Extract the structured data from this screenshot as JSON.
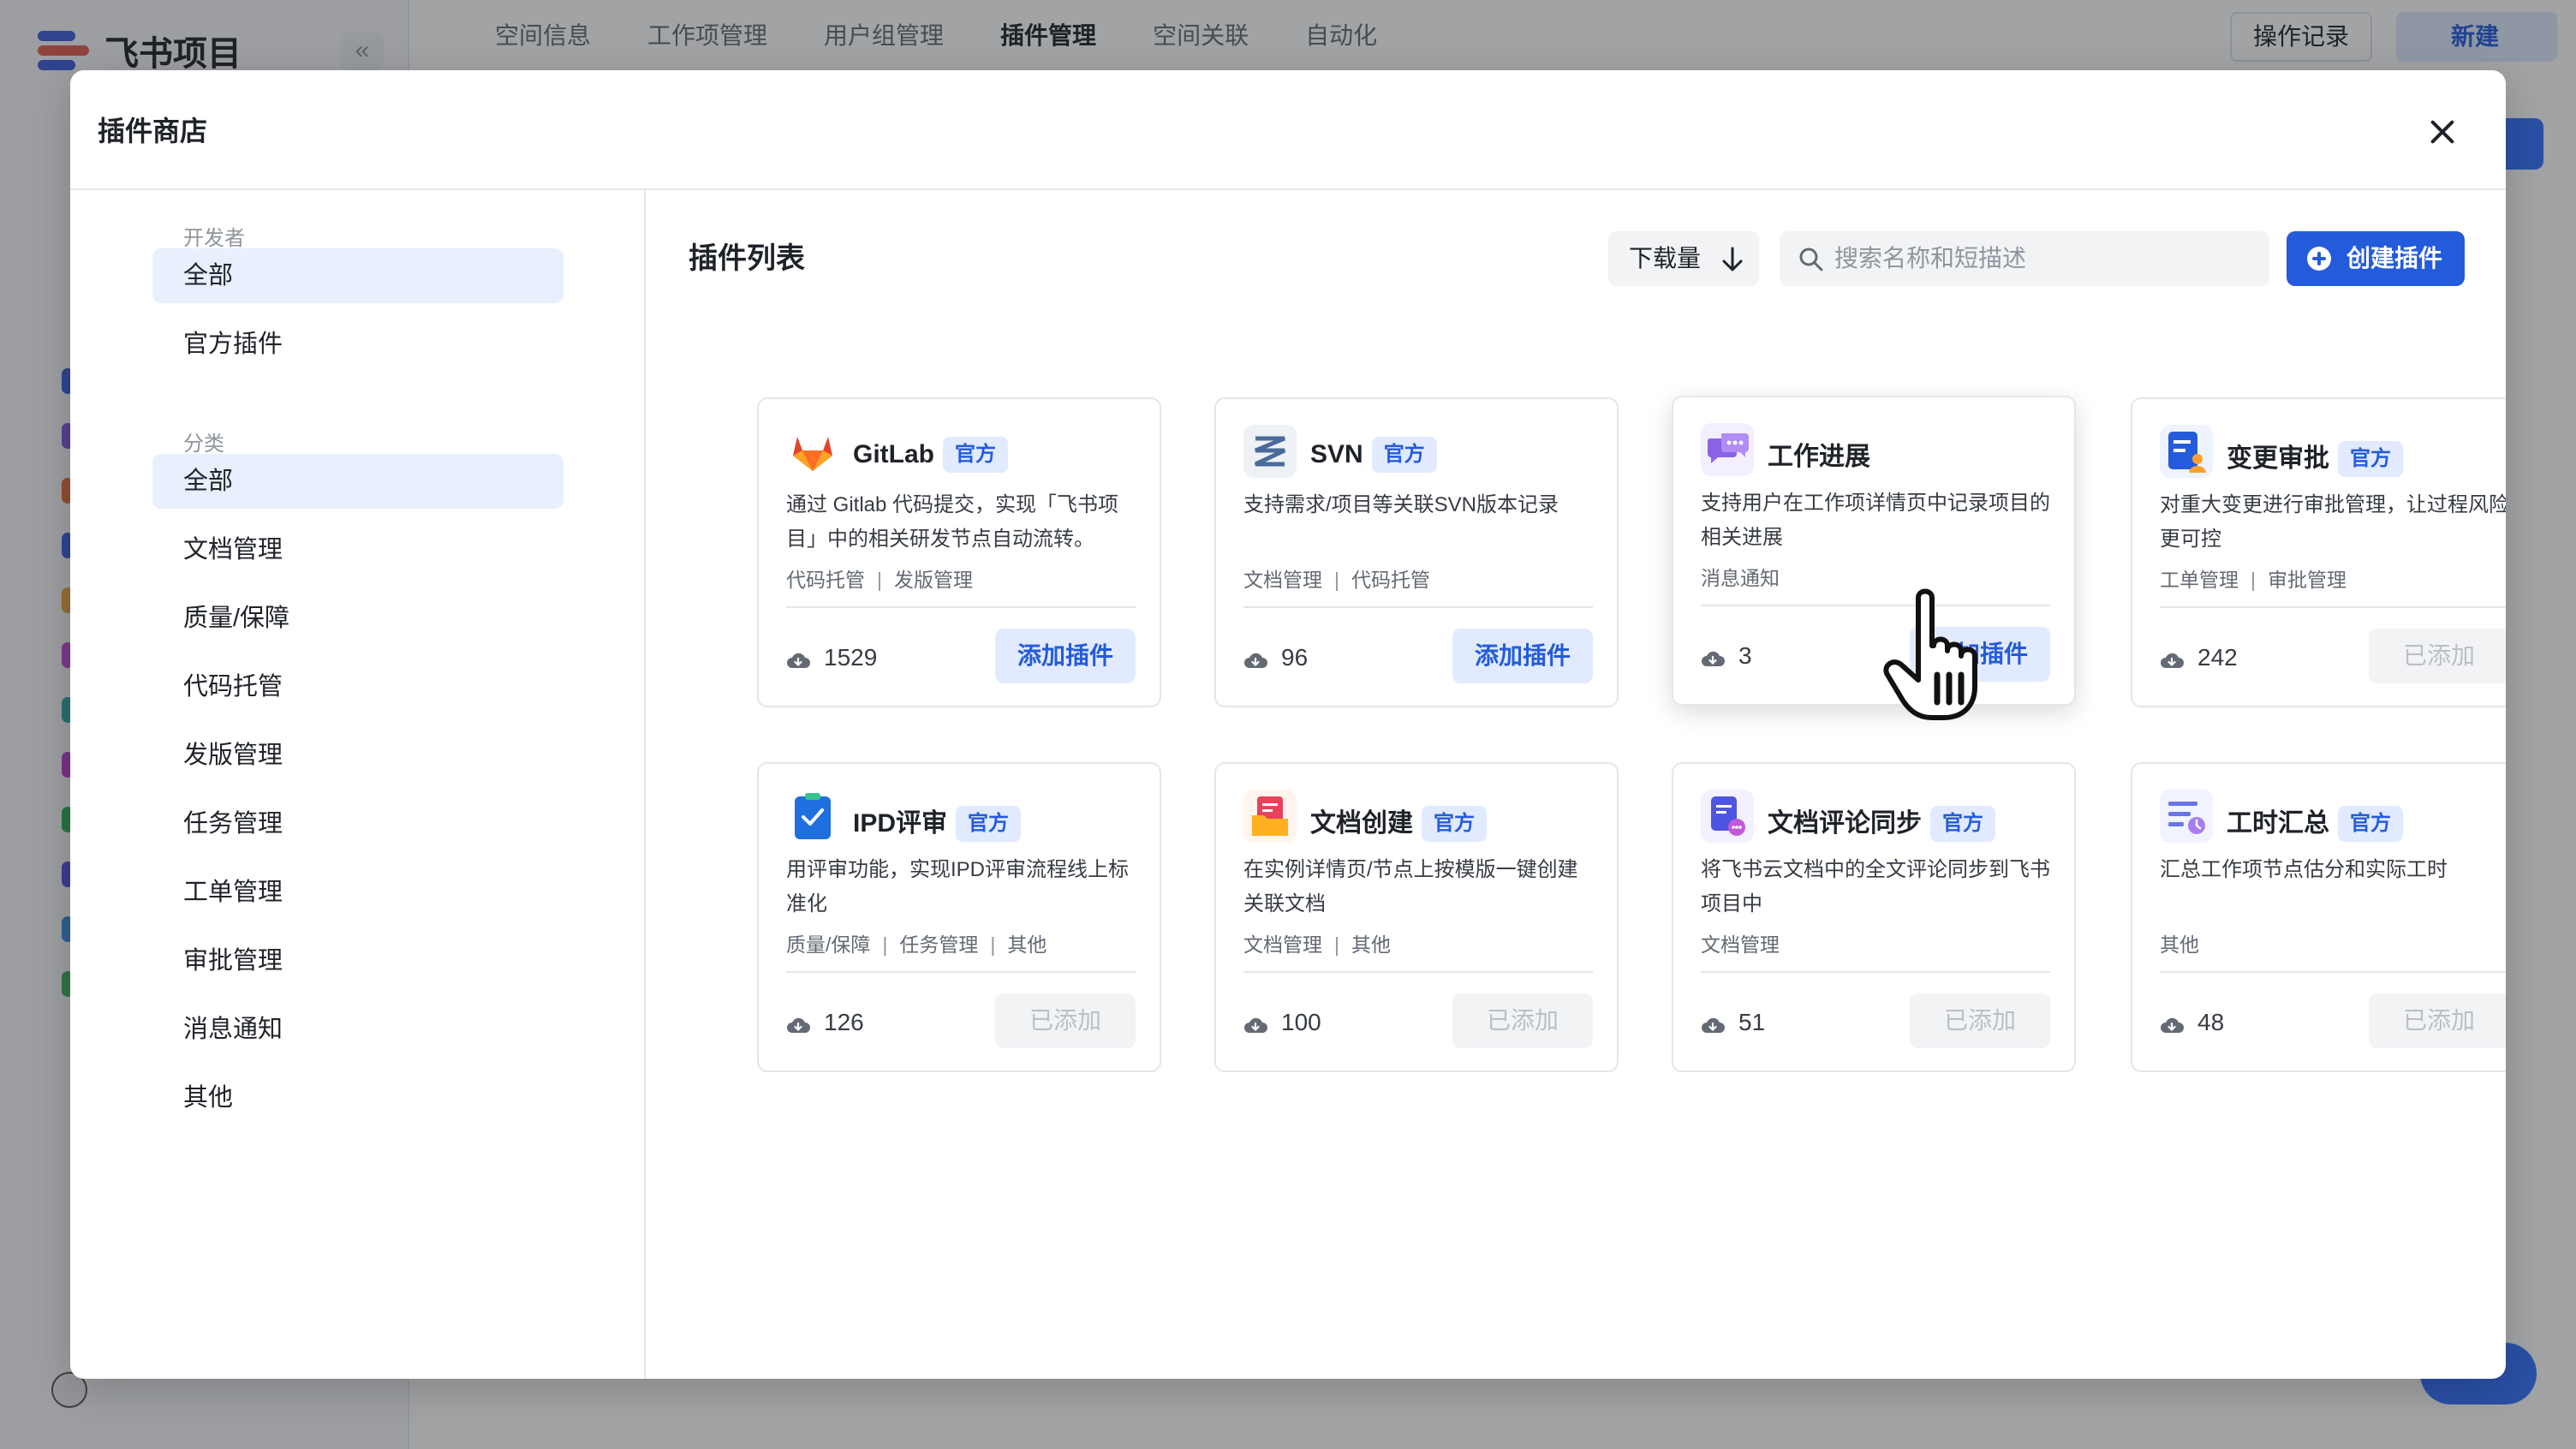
{
  "background": {
    "logo_text": "飞书项目",
    "collapse_glyph": "«",
    "top_nav": [
      "空间信息",
      "工作项管理",
      "用户组管理",
      "插件管理",
      "空间关联",
      "自动化"
    ],
    "top_nav_active_index": 3,
    "oplog_label": "操作记录",
    "new_label": "新建"
  },
  "modal": {
    "title": "插件商店",
    "close_icon": "close-icon"
  },
  "filters": {
    "developer_title": "开发者",
    "developer_items": [
      {
        "label": "全部",
        "active": true
      },
      {
        "label": "官方插件",
        "active": false
      }
    ],
    "category_title": "分类",
    "category_items": [
      {
        "label": "全部",
        "active": true
      },
      {
        "label": "文档管理",
        "active": false
      },
      {
        "label": "质量/保障",
        "active": false
      },
      {
        "label": "代码托管",
        "active": false
      },
      {
        "label": "发版管理",
        "active": false
      },
      {
        "label": "任务管理",
        "active": false
      },
      {
        "label": "工单管理",
        "active": false
      },
      {
        "label": "审批管理",
        "active": false
      },
      {
        "label": "消息通知",
        "active": false
      },
      {
        "label": "其他",
        "active": false
      }
    ]
  },
  "main": {
    "list_title": "插件列表",
    "sort_label": "下载量",
    "search_placeholder": "搜索名称和短描述",
    "search_value": "",
    "create_label": "创建插件",
    "official_badge": "官方",
    "plugins": [
      {
        "name": "GitLab",
        "official": true,
        "icon": "gitlab-icon",
        "desc": "通过 Gitlab 代码提交，实现「飞书项目」中的相关研发节点自动流转。",
        "tags": [
          "代码托管",
          "发版管理"
        ],
        "downloads": "1529",
        "action": "添加插件",
        "added": false
      },
      {
        "name": "SVN",
        "official": true,
        "icon": "svn-icon",
        "desc": "支持需求/项目等关联SVN版本记录",
        "tags": [
          "文档管理",
          "代码托管"
        ],
        "downloads": "96",
        "action": "添加插件",
        "added": false
      },
      {
        "name": "工作进展",
        "official": false,
        "icon": "chat-bubble-icon",
        "desc": "支持用户在工作项详情页中记录项目的相关进展",
        "tags": [
          "消息通知"
        ],
        "downloads": "3",
        "action": "添加插件",
        "added": false
      },
      {
        "name": "变更审批",
        "official": true,
        "icon": "approval-doc-icon",
        "desc": "对重大变更进行审批管理，让过程风险更可控",
        "tags": [
          "工单管理",
          "审批管理"
        ],
        "downloads": "242",
        "action": "已添加",
        "added": true
      },
      {
        "name": "IPD评审",
        "official": true,
        "icon": "checklist-icon",
        "desc": "用评审功能，实现IPD评审流程线上标准化",
        "tags": [
          "质量/保障",
          "任务管理",
          "其他"
        ],
        "downloads": "126",
        "action": "已添加",
        "added": true
      },
      {
        "name": "文档创建",
        "official": true,
        "icon": "doc-create-icon",
        "desc": "在实例详情页/节点上按模版一键创建关联文档",
        "tags": [
          "文档管理",
          "其他"
        ],
        "downloads": "100",
        "action": "已添加",
        "added": true
      },
      {
        "name": "文档评论同步",
        "official": true,
        "icon": "doc-comment-icon",
        "desc": "将飞书云文档中的全文评论同步到飞书项目中",
        "tags": [
          "文档管理"
        ],
        "downloads": "51",
        "action": "已添加",
        "added": true
      },
      {
        "name": "工时汇总",
        "official": true,
        "icon": "timesheet-icon",
        "desc": "汇总工作项节点估分和实际工时",
        "tags": [
          "其他"
        ],
        "downloads": "48",
        "action": "已添加",
        "added": true
      }
    ]
  },
  "colors": {
    "accent": "#245bdb",
    "accent_light": "#e1eaff",
    "filter_active_bg": "#e8effd"
  }
}
